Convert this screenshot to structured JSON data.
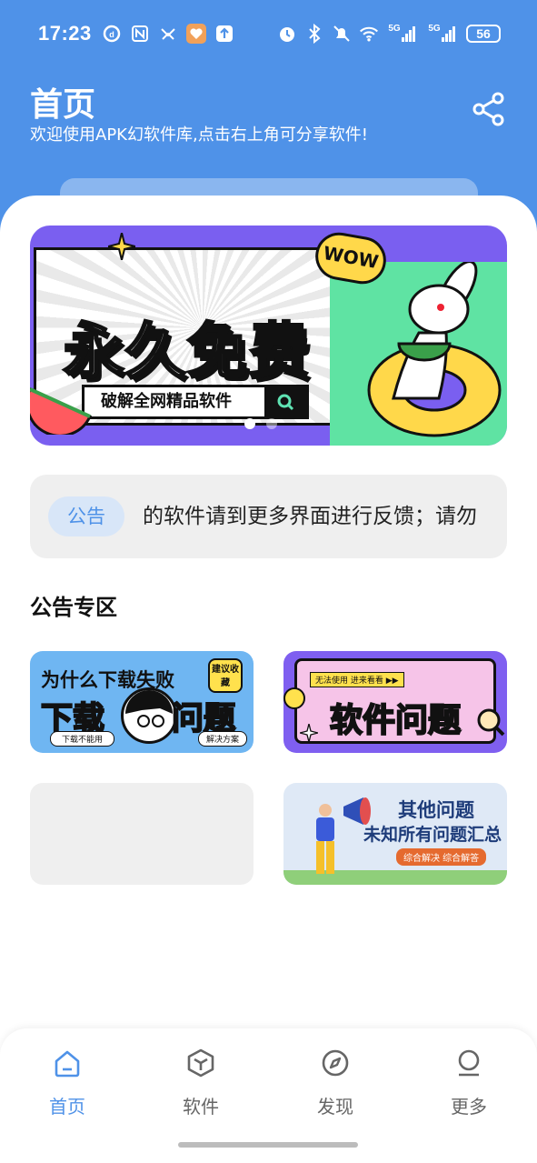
{
  "status_bar": {
    "time": "17:23",
    "network_1": "5G",
    "network_2": "5G",
    "battery": "56"
  },
  "header": {
    "title": "首页",
    "subtitle": "欢迎使用APK幻软件库,点击右上角可分享软件!",
    "share_icon": "share-icon"
  },
  "banner": {
    "title": "永久免费",
    "search_text": "破解全网精品软件",
    "badge": "WOW",
    "active_index": 0,
    "slide_count": 2
  },
  "notice": {
    "tag": "公告",
    "text": "的软件请到更多界面进行反馈；请勿"
  },
  "section": {
    "title": "公告专区"
  },
  "cards": {
    "download": {
      "headline": "为什么下载失败",
      "big_left": "下载",
      "big_right": "问题",
      "stamp": "建议收藏",
      "pill_left": "下载不能用",
      "pill_right": "解决方案"
    },
    "software": {
      "tag": "无法使用 进来看看 ▶▶",
      "title": "软件问题"
    },
    "other": {
      "title": "其他问题",
      "subtitle": "未知所有问题汇总",
      "pill": "综合解决 综合解答"
    }
  },
  "bottom_nav": {
    "items": [
      {
        "label": "首页",
        "icon": "home-icon",
        "active": true
      },
      {
        "label": "软件",
        "icon": "cube-icon",
        "active": false
      },
      {
        "label": "发现",
        "icon": "compass-icon",
        "active": false
      },
      {
        "label": "更多",
        "icon": "profile-icon",
        "active": false
      }
    ]
  },
  "colors": {
    "accent": "#4f92e8",
    "inactive": "#666666",
    "banner_purple": "#7a5ff0"
  }
}
